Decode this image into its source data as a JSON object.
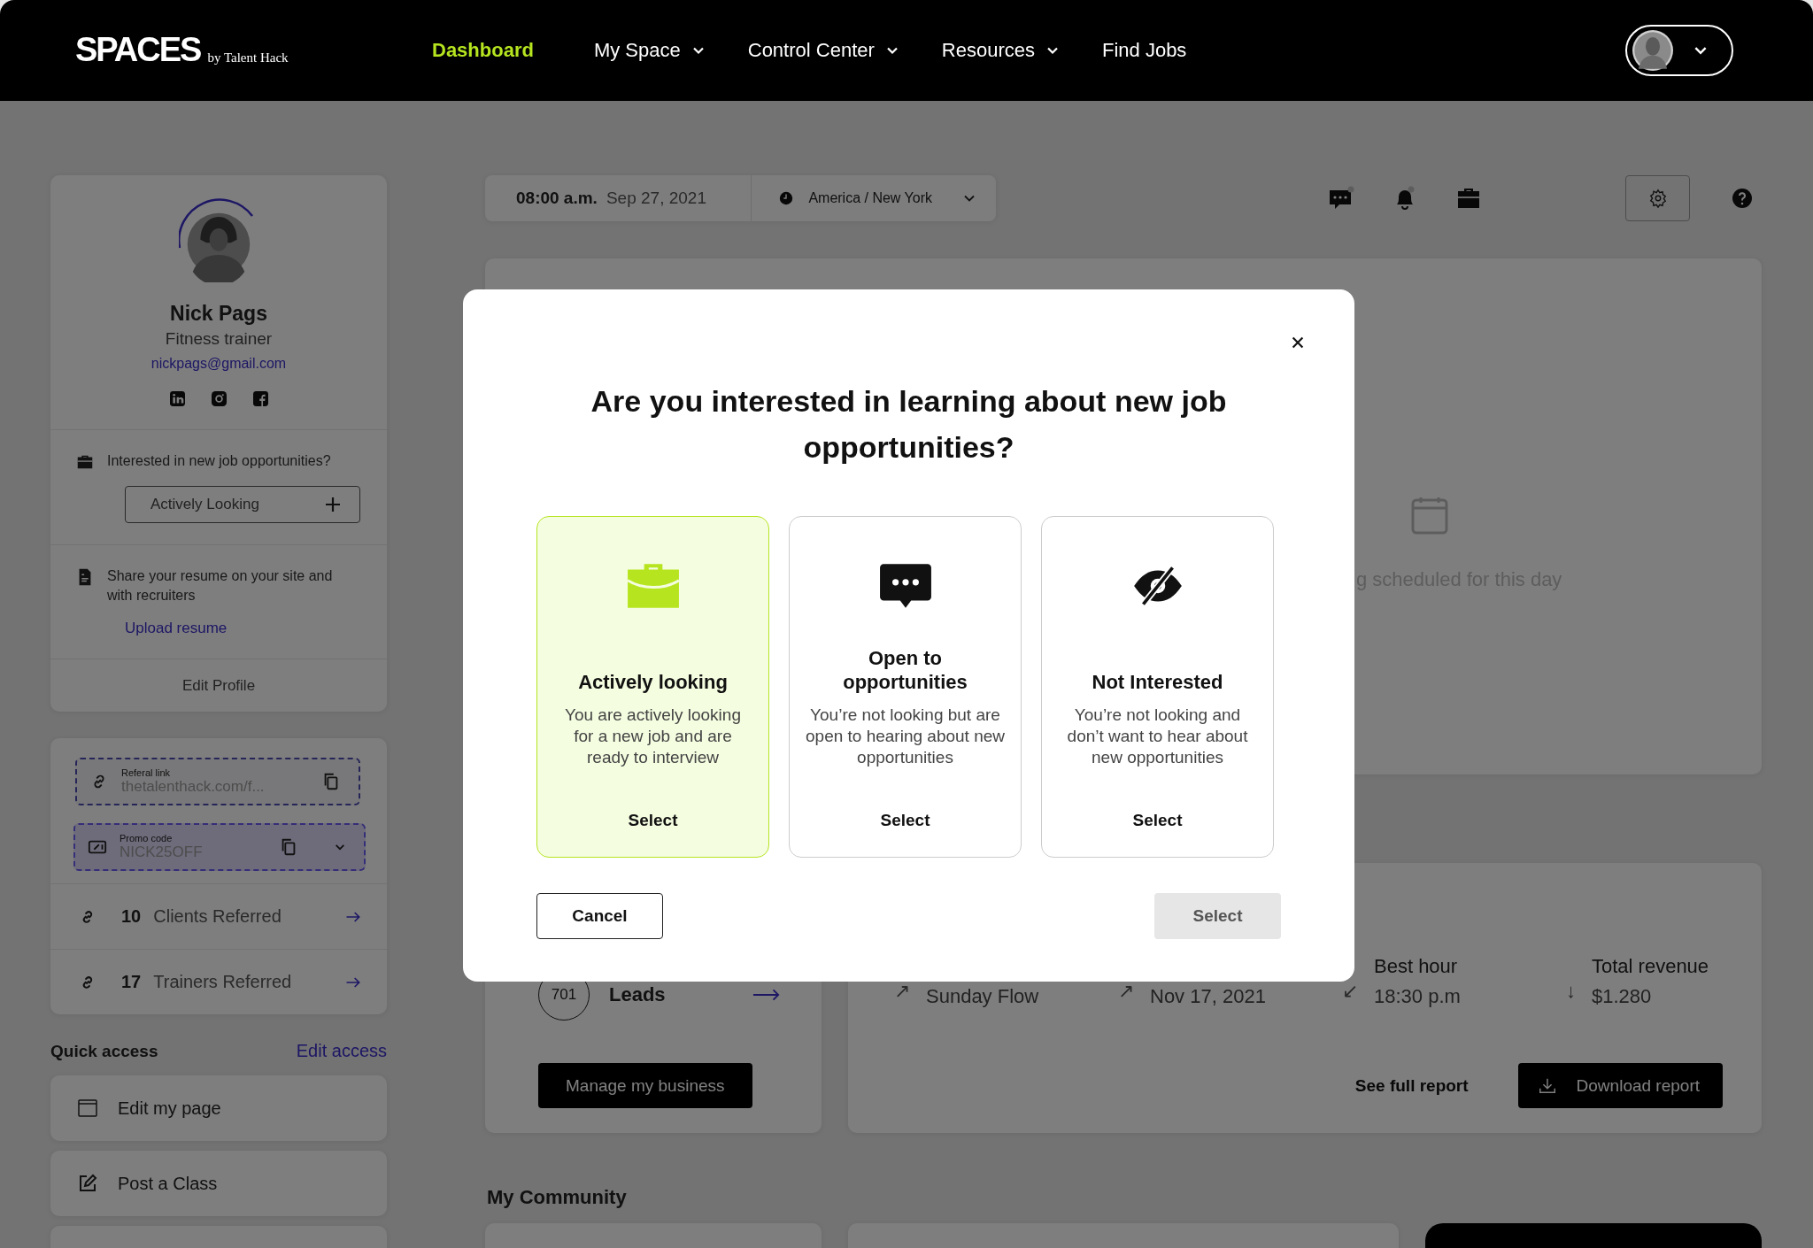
{
  "nav": {
    "logo": "SPACES",
    "logo_sub": "by Talent Hack",
    "links": [
      {
        "label": "Dashboard",
        "selected": true,
        "dropdown": false
      },
      {
        "label": "My Space",
        "selected": false,
        "dropdown": true
      },
      {
        "label": "Control Center",
        "selected": false,
        "dropdown": true
      },
      {
        "label": "Resources",
        "selected": false,
        "dropdown": true
      },
      {
        "label": "Find Jobs",
        "selected": false,
        "dropdown": false
      }
    ]
  },
  "profile": {
    "name": "Nick Pags",
    "role": "Fitness trainer",
    "email": "nickpags@gmail.com",
    "job_question": "Interested in new job opportunities?",
    "job_status": "Actively Looking",
    "resume_text": "Share your resume on your site and with recruiters",
    "resume_link": "Upload resume",
    "edit_label": "Edit Profile"
  },
  "referral": {
    "link_label": "Referal link",
    "link_value": "thetalenthack.com/f...",
    "promo_label": "Promo code",
    "promo_value": "NICK25OFF",
    "stats": [
      {
        "count": "10",
        "label": "Clients Referred"
      },
      {
        "count": "17",
        "label": "Trainers Referred"
      }
    ]
  },
  "quick_access": {
    "title": "Quick access",
    "edit_label": "Edit access",
    "items": [
      {
        "kind": "page",
        "label": "Edit my page"
      },
      {
        "kind": "edit",
        "label": "Post a Class"
      }
    ]
  },
  "toolbar": {
    "time": "08:00 a.m.",
    "date": "Sep 27, 2021",
    "timezone": "America / New York",
    "messages_unread": true,
    "notifications_unread": true
  },
  "schedule": {
    "empty_text": "g scheduled for this day"
  },
  "business": {
    "count": "701",
    "label": "Leads",
    "button": "Manage my business"
  },
  "report": {
    "stats": [
      {
        "arrow": "↗",
        "value": "Sunday Flow"
      },
      {
        "arrow": "↗",
        "value": "Nov 17, 2021"
      },
      {
        "arrow": "↙",
        "label": "Best hour",
        "value": "18:30 p.m"
      },
      {
        "arrow": "↓",
        "label": "Total revenue",
        "value": "$1.280"
      }
    ],
    "link": "See full report",
    "button": "Download report"
  },
  "community": {
    "title": "My Community"
  },
  "modal": {
    "title": "Are you interested in learning about new job opportunities?",
    "options": [
      {
        "kind": "briefcase",
        "title": "Actively looking",
        "description": "You are actively looking for a new job and are ready to interview",
        "action": "Select",
        "selected": true
      },
      {
        "kind": "chat",
        "title": "Open to opportunities",
        "description": "You’re not looking but are open to hearing about new opportunities",
        "action": "Select",
        "selected": false
      },
      {
        "kind": "hidden",
        "title": "Not Interested",
        "description": "You’re not looking and don’t want to hear about new opportunities",
        "action": "Select",
        "selected": false
      }
    ],
    "cancel": "Cancel",
    "confirm": "Select",
    "confirm_disabled": true
  }
}
